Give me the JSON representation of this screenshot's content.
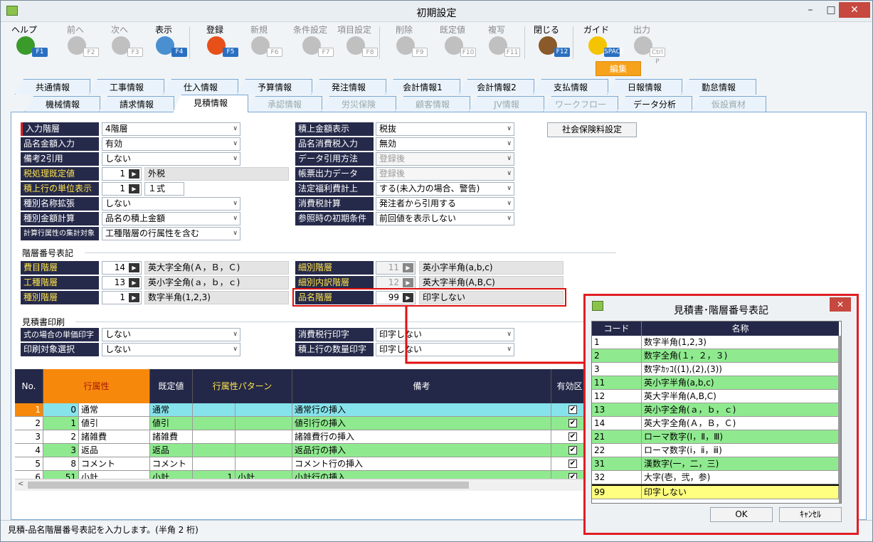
{
  "window": {
    "title": "初期設定",
    "min": "–",
    "max": "□",
    "close": "✕"
  },
  "toolbar": [
    {
      "label": "ヘルプ",
      "key": "F1",
      "icon": "question-icon",
      "color": "#3a9b2a",
      "disabled": false
    },
    {
      "label": "前へ",
      "key": "F2",
      "icon": "arrow-left-icon",
      "color": "#c0c0c0",
      "disabled": true
    },
    {
      "label": "次へ",
      "key": "F3",
      "icon": "arrow-right-icon",
      "color": "#c0c0c0",
      "disabled": true
    },
    {
      "label": "表示",
      "key": "F4",
      "icon": "magnifier-icon",
      "color": "#4a8fd0",
      "disabled": false
    },
    {
      "label": "登録",
      "key": "F5",
      "icon": "ok-icon",
      "color": "#e8501a",
      "disabled": false
    },
    {
      "label": "新規",
      "key": "F6",
      "icon": "new-doc-icon",
      "color": "#c0c0c0",
      "disabled": true
    },
    {
      "label": "条件設定",
      "key": "F7",
      "icon": "condition-icon",
      "color": "#c0c0c0",
      "disabled": true
    },
    {
      "label": "項目設定",
      "key": "F8",
      "icon": "gear-icon",
      "color": "#c0c0c0",
      "disabled": true
    },
    {
      "label": "削除",
      "key": "F9",
      "icon": "trash-icon",
      "color": "#c0c0c0",
      "disabled": true
    },
    {
      "label": "既定値",
      "key": "F10",
      "icon": "refresh-icon",
      "color": "#c0c0c0",
      "disabled": true
    },
    {
      "label": "複写",
      "key": "F11",
      "icon": "copy-icon",
      "color": "#c0c0c0",
      "disabled": true
    },
    {
      "label": "閉じる",
      "key": "F12",
      "icon": "door-icon",
      "color": "#8a5a2a",
      "disabled": false
    },
    {
      "label": "ガイド",
      "key": "SPACE",
      "icon": "bulb-icon",
      "color": "#f5c400",
      "disabled": false
    },
    {
      "label": "出力",
      "key": "Ctrl P",
      "icon": "print-icon",
      "color": "#c0c0c0",
      "disabled": true
    }
  ],
  "edit_badge": "編集",
  "tabs_row1": [
    {
      "label": "共通情報"
    },
    {
      "label": "工事情報"
    },
    {
      "label": "仕入情報"
    },
    {
      "label": "予算情報"
    },
    {
      "label": "発注情報"
    },
    {
      "label": "会計情報1"
    },
    {
      "label": "会計情報2"
    },
    {
      "label": "支払情報"
    },
    {
      "label": "日報情報"
    },
    {
      "label": "勤怠情報"
    }
  ],
  "tabs_row2": [
    {
      "label": "機械情報",
      "dis": false
    },
    {
      "label": "請求情報",
      "dis": false
    },
    {
      "label": "見積情報",
      "dis": false
    },
    {
      "label": "承認情報",
      "dis": true
    },
    {
      "label": "労災保険",
      "dis": true
    },
    {
      "label": "顧客情報",
      "dis": true
    },
    {
      "label": "JV情報",
      "dis": true
    },
    {
      "label": "ワークフロー",
      "dis": true
    },
    {
      "label": "データ分析",
      "dis": false
    },
    {
      "label": "仮設資材",
      "dis": true
    }
  ],
  "left_fields": {
    "input_level": {
      "label": "入力階層",
      "value": "4階層"
    },
    "item_amount": {
      "label": "品名金額入力",
      "value": "有効"
    },
    "remarks2": {
      "label": "備考2引用",
      "value": "しない"
    },
    "tax_default": {
      "label": "税処理既定値",
      "code": "1",
      "value": "外税"
    },
    "unit_display": {
      "label": "積上行の単位表示",
      "code": "1",
      "value": "１式"
    },
    "type_ext": {
      "label": "種別名称拡張",
      "value": "しない"
    },
    "type_amount": {
      "label": "種別金額計算",
      "value": "品名の積上金額"
    },
    "calc_target": {
      "label": "計算行属性の集計対象",
      "value": "工種階層の行属性を含む"
    }
  },
  "right_fields": {
    "stack_amount": {
      "label": "積上金額表示",
      "value": "税抜"
    },
    "item_tax": {
      "label": "品名消費税入力",
      "value": "無効"
    },
    "data_cite": {
      "label": "データ引用方法",
      "value": "登録後"
    },
    "form_out": {
      "label": "帳票出力データ",
      "value": "登録後"
    },
    "welfare": {
      "label": "法定福利費計上",
      "value": "する(未入力の場合、警告)"
    },
    "tax_calc": {
      "label": "消費税計算",
      "value": "発注者から引用する"
    },
    "ref_init": {
      "label": "参照時の初期条件",
      "value": "前回値を表示しない"
    }
  },
  "social_button": "社会保険料設定",
  "level_section": {
    "title": "階層番号表記",
    "expense": {
      "label": "費目階層",
      "code": "14",
      "value": "英大字全角(Ａ，Ｂ，Ｃ)"
    },
    "process": {
      "label": "工種階層",
      "code": "13",
      "value": "英小字全角(ａ，ｂ，ｃ)"
    },
    "type": {
      "label": "種別階層",
      "code": "1",
      "value": "数字半角(1,2,3)"
    },
    "detail": {
      "label": "細別階層",
      "code": "11",
      "value": "英小字半角(a,b,c)"
    },
    "detail_inner": {
      "label": "細別内訳階層",
      "code": "12",
      "value": "英大字半角(A,B,C)"
    },
    "item": {
      "label": "品名階層",
      "code": "99",
      "value": "印字しない"
    }
  },
  "print_section": {
    "title": "見積書印刷",
    "unit_price": {
      "label": "式の場合の単価印字",
      "value": "しない"
    },
    "print_target": {
      "label": "印刷対象選択",
      "value": "しない"
    },
    "tax_line": {
      "label": "消費税行印字",
      "value": "印字しない"
    },
    "qty_line": {
      "label": "積上行の数量印字",
      "value": "印字しない"
    }
  },
  "grid": {
    "headers": [
      "No.",
      "行属性",
      "既定値",
      "行属性パターン",
      "備考",
      "有効区"
    ],
    "rows": [
      {
        "no": "1",
        "code": "0",
        "attr": "通常",
        "def": "通常",
        "pcode": "",
        "pat": "",
        "note": "通常行の挿入",
        "check": "✔",
        "bg": "#86e3ec"
      },
      {
        "no": "2",
        "code": "1",
        "attr": "値引",
        "def": "値引",
        "pcode": "",
        "pat": "",
        "note": "値引行の挿入",
        "check": "✔",
        "bg": "#8fea8f"
      },
      {
        "no": "3",
        "code": "2",
        "attr": "諸雑費",
        "def": "諸雑費",
        "pcode": "",
        "pat": "",
        "note": "諸雑費行の挿入",
        "check": "✔",
        "bg": "#ffffff"
      },
      {
        "no": "4",
        "code": "3",
        "attr": "返品",
        "def": "返品",
        "pcode": "",
        "pat": "",
        "note": "返品行の挿入",
        "check": "✔",
        "bg": "#8fea8f"
      },
      {
        "no": "5",
        "code": "8",
        "attr": "コメント",
        "def": "コメント",
        "pcode": "",
        "pat": "",
        "note": "コメント行の挿入",
        "check": "✔",
        "bg": "#ffffff"
      },
      {
        "no": "6",
        "code": "51",
        "attr": "小計",
        "def": "小計",
        "pcode": "1",
        "pat": "小計",
        "note": "小計行の挿入",
        "check": "✔",
        "bg": "#8fea8f"
      }
    ]
  },
  "status": "見積-品名階層番号表記を入力します。(半角 2 桁)",
  "dialog": {
    "title": "見積書･階層番号表記",
    "close": "✕",
    "col_code": "コード",
    "col_name": "名称",
    "items": [
      {
        "code": "1",
        "name": "数字半角(1,2,3)",
        "bg": "#ffffff"
      },
      {
        "code": "2",
        "name": "数字全角(１，２，３)",
        "bg": "#8fea8f"
      },
      {
        "code": "3",
        "name": "数字ｶｯｺ((1),(2),(3))",
        "bg": "#ffffff"
      },
      {
        "code": "11",
        "name": "英小字半角(a,b,c)",
        "bg": "#8fea8f"
      },
      {
        "code": "12",
        "name": "英大字半角(A,B,C)",
        "bg": "#ffffff"
      },
      {
        "code": "13",
        "name": "英小字全角(ａ，ｂ，ｃ)",
        "bg": "#8fea8f"
      },
      {
        "code": "14",
        "name": "英大字全角(Ａ，Ｂ，Ｃ)",
        "bg": "#ffffff"
      },
      {
        "code": "21",
        "name": "ローマ数字(Ⅰ，Ⅱ，Ⅲ)",
        "bg": "#8fea8f"
      },
      {
        "code": "22",
        "name": "ローマ数字(ⅰ，ⅱ，ⅲ)",
        "bg": "#ffffff"
      },
      {
        "code": "31",
        "name": "漢数字(一，二，三)",
        "bg": "#8fea8f"
      },
      {
        "code": "32",
        "name": "大字(壱，弐，参)",
        "bg": "#ffffff"
      },
      {
        "code": "99",
        "name": "印字しない",
        "bg": "#ffff80"
      }
    ],
    "ok": "OK",
    "cancel": "ｷｬﾝｾﾙ"
  }
}
